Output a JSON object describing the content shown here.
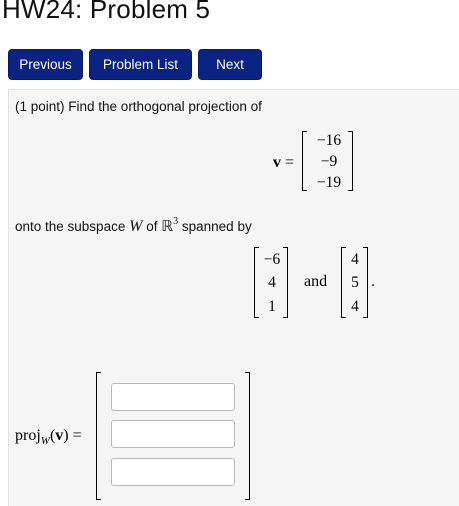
{
  "page": {
    "title": "HW24: Problem 5"
  },
  "nav": {
    "previous": "Previous",
    "problem_list": "Problem List",
    "next": "Next"
  },
  "problem": {
    "prompt": "(1 point) Find the orthogonal projection of",
    "v_label": "v",
    "equals": "=",
    "v_vector": [
      "−16",
      "−9",
      "−19"
    ],
    "onto_text_1": "onto the subspace",
    "W": "W",
    "onto_text_2": "of",
    "R": "ℝ",
    "R_exp": "3",
    "onto_text_3": "spanned by",
    "basis1": [
      "−6",
      "4",
      "1"
    ],
    "and": "and",
    "basis2": [
      "4",
      "5",
      "4"
    ],
    "period": ".",
    "proj_label": "proj",
    "proj_sub": "W",
    "proj_arg_open": "(",
    "proj_arg_v": "v",
    "proj_arg_close": ")",
    "proj_equals": "=",
    "answers": [
      "",
      "",
      ""
    ]
  },
  "colors": {
    "button_bg": "#0a2282",
    "button_text": "#ffffff",
    "panel_bg": "#f5f5f5"
  }
}
